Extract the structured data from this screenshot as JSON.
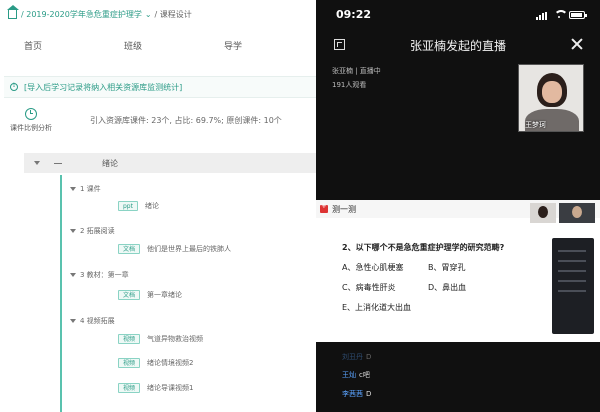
{
  "left": {
    "breadcrumb": {
      "part1": "/ 2019-2020学年急危重症护理学",
      "part2": "/ 课程设计"
    },
    "nav": [
      "首页",
      "班级",
      "导学"
    ],
    "banner": "[导入后学习记录将纳入相关资源库监测统计]",
    "stats": {
      "label": "课件比例分析",
      "summary": "引入资源库课件: 23个, 占比: 69.7%; 原创课件: 10个"
    },
    "chapter": {
      "number": "一",
      "title": "绪论"
    },
    "sections": [
      {
        "label": "1  课件",
        "resources": [
          {
            "tag": "ppt",
            "title": "绪论"
          }
        ]
      },
      {
        "label": "2  拓展阅读",
        "resources": [
          {
            "tag": "文档",
            "title": "他们是世界上最后的铁肺人"
          }
        ]
      },
      {
        "label": "3  教材：第一章",
        "resources": [
          {
            "tag": "文档",
            "title": "第一章绪论"
          }
        ]
      },
      {
        "label": "4  视频拓展",
        "resources": [
          {
            "tag": "视频",
            "title": "气道异物救治视频"
          },
          {
            "tag": "视频",
            "title": "绪论情境视频2"
          },
          {
            "tag": "视频",
            "title": "绪论导课视频1"
          }
        ]
      }
    ]
  },
  "right": {
    "time": "09:22",
    "live_title": "张亚楠发起的直播",
    "host_status": "张亚楠 | 直播中",
    "viewers": "191人观看",
    "cam_label": "王梦珂",
    "quiz": {
      "title": "测一测",
      "question": "2、以下哪个不是急危重症护理学的研究范畴?",
      "options": [
        "A、急性心肌梗塞",
        "B、胃穿孔",
        "C、病毒性肝炎",
        "D、鼻出血",
        "E、上消化道大出血"
      ]
    },
    "chat": [
      {
        "who": "刘丑丹",
        "msg": "D"
      },
      {
        "who": "王灿",
        "msg": "c吧"
      },
      {
        "who": "李茜茜",
        "msg": "D"
      }
    ]
  }
}
